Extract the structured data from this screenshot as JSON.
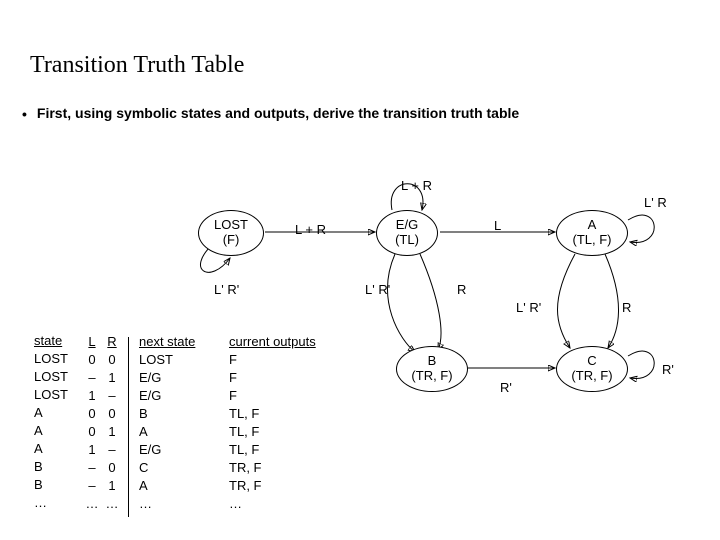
{
  "title": "Transition Truth Table",
  "bullet": "First, using symbolic states and outputs, derive the transition truth table",
  "states": {
    "lost": {
      "l1": "LOST",
      "l2": "(F)"
    },
    "eg": {
      "l1": "E/G",
      "l2": "(TL)"
    },
    "a": {
      "l1": "A",
      "l2": "(TL, F)"
    },
    "b": {
      "l1": "B",
      "l2": "(TR, F)"
    },
    "c": {
      "l1": "C",
      "l2": "(TR, F)"
    }
  },
  "edges": {
    "lost_self": "L' R'",
    "lost_to_eg": "L + R",
    "eg_self_top": "L + R",
    "eg_to_a": "L",
    "a_self": "L' R",
    "eg_to_b_left": "L' R'",
    "eg_to_b_right": "R",
    "a_to_c_via": "L' R'",
    "down_r": "R",
    "b_to_c": "R'",
    "c_self": "R'"
  },
  "table": {
    "headers": {
      "state": "state",
      "L": "L",
      "R": "R",
      "next": "next state",
      "out": "current outputs"
    },
    "rows": [
      {
        "state": "LOST",
        "L": "0",
        "R": "0",
        "next": "LOST",
        "out": "F"
      },
      {
        "state": "LOST",
        "L": "–",
        "R": "1",
        "next": "E/G",
        "out": "F"
      },
      {
        "state": "LOST",
        "L": "1",
        "R": "–",
        "next": "E/G",
        "out": "F"
      },
      {
        "state": "A",
        "L": "0",
        "R": "0",
        "next": "B",
        "out": "TL, F"
      },
      {
        "state": "A",
        "L": "0",
        "R": "1",
        "next": "A",
        "out": "TL, F"
      },
      {
        "state": "A",
        "L": "1",
        "R": "–",
        "next": "E/G",
        "out": "TL, F"
      },
      {
        "state": "B",
        "L": "–",
        "R": "0",
        "next": "C",
        "out": "TR, F"
      },
      {
        "state": "B",
        "L": "–",
        "R": "1",
        "next": "A",
        "out": "TR, F"
      },
      {
        "state": "…",
        "L": "…",
        "R": "…",
        "next": "…",
        "out": "…"
      }
    ]
  },
  "chart_data": {
    "type": "table",
    "title": "Transition Truth Table",
    "columns": [
      "state",
      "L",
      "R",
      "next state",
      "current outputs"
    ],
    "rows": [
      [
        "LOST",
        "0",
        "0",
        "LOST",
        "F"
      ],
      [
        "LOST",
        "–",
        "1",
        "E/G",
        "F"
      ],
      [
        "LOST",
        "1",
        "–",
        "E/G",
        "F"
      ],
      [
        "A",
        "0",
        "0",
        "B",
        "TL, F"
      ],
      [
        "A",
        "0",
        "1",
        "A",
        "TL, F"
      ],
      [
        "A",
        "1",
        "–",
        "E/G",
        "TL, F"
      ],
      [
        "B",
        "–",
        "0",
        "C",
        "TR, F"
      ],
      [
        "B",
        "–",
        "1",
        "A",
        "TR, F"
      ],
      [
        "…",
        "…",
        "…",
        "…",
        "…"
      ]
    ],
    "state_diagram": {
      "states": [
        "LOST (F)",
        "E/G (TL)",
        "A (TL, F)",
        "B (TR, F)",
        "C (TR, F)"
      ],
      "transitions": [
        {
          "from": "LOST",
          "to": "LOST",
          "on": "L' R'"
        },
        {
          "from": "LOST",
          "to": "E/G",
          "on": "L + R"
        },
        {
          "from": "E/G",
          "to": "E/G",
          "on": "L + R"
        },
        {
          "from": "E/G",
          "to": "A",
          "on": "L"
        },
        {
          "from": "A",
          "to": "A",
          "on": "L' R"
        },
        {
          "from": "E/G",
          "to": "B",
          "on": "L' R'"
        },
        {
          "from": "E/G",
          "to": "B",
          "on": "R"
        },
        {
          "from": "A",
          "to": "C",
          "on": "L' R'"
        },
        {
          "from": "A",
          "to": "C",
          "on": "R"
        },
        {
          "from": "B",
          "to": "C",
          "on": "R'"
        },
        {
          "from": "C",
          "to": "C",
          "on": "R'"
        }
      ]
    }
  }
}
